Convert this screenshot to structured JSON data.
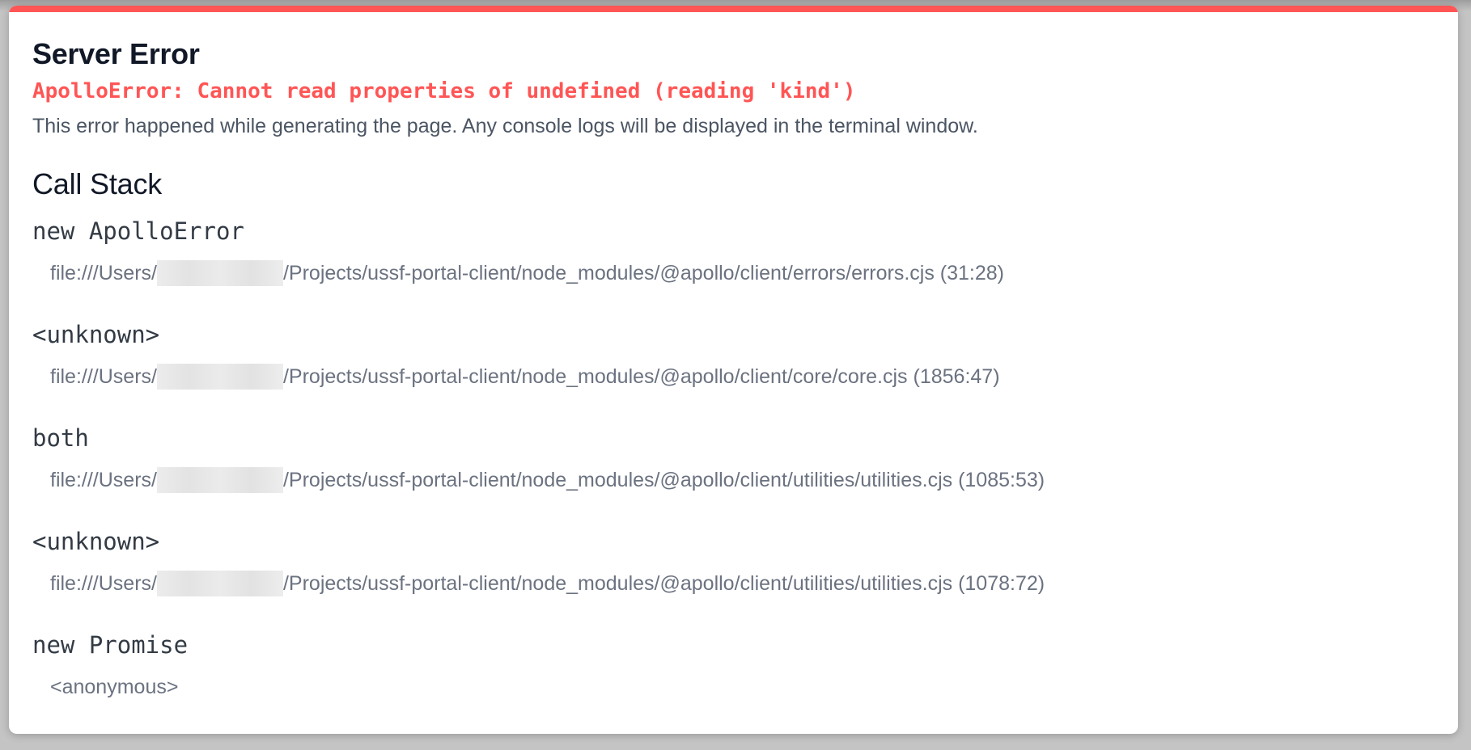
{
  "window": {
    "accent_color": "#ff5555"
  },
  "error": {
    "title": "Server Error",
    "message": "ApolloError: Cannot read properties of undefined (reading 'kind')",
    "description": "This error happened while generating the page. Any console logs will be displayed in the terminal window."
  },
  "call_stack": {
    "heading": "Call Stack",
    "frames": [
      {
        "name": "new ApolloError",
        "location_prefix": "file:///Users/",
        "location_suffix": "/Projects/ussf-portal-client/node_modules/@apollo/client/errors/errors.cjs (31:28)"
      },
      {
        "name": "<unknown>",
        "location_prefix": "file:///Users/",
        "location_suffix": "/Projects/ussf-portal-client/node_modules/@apollo/client/core/core.cjs (1856:47)"
      },
      {
        "name": "both",
        "location_prefix": "file:///Users/",
        "location_suffix": "/Projects/ussf-portal-client/node_modules/@apollo/client/utilities/utilities.cjs (1085:53)"
      },
      {
        "name": "<unknown>",
        "location_prefix": "file:///Users/",
        "location_suffix": "/Projects/ussf-portal-client/node_modules/@apollo/client/utilities/utilities.cjs (1078:72)"
      },
      {
        "name": "new Promise",
        "location_prefix": "<anonymous>",
        "location_suffix": ""
      }
    ]
  }
}
